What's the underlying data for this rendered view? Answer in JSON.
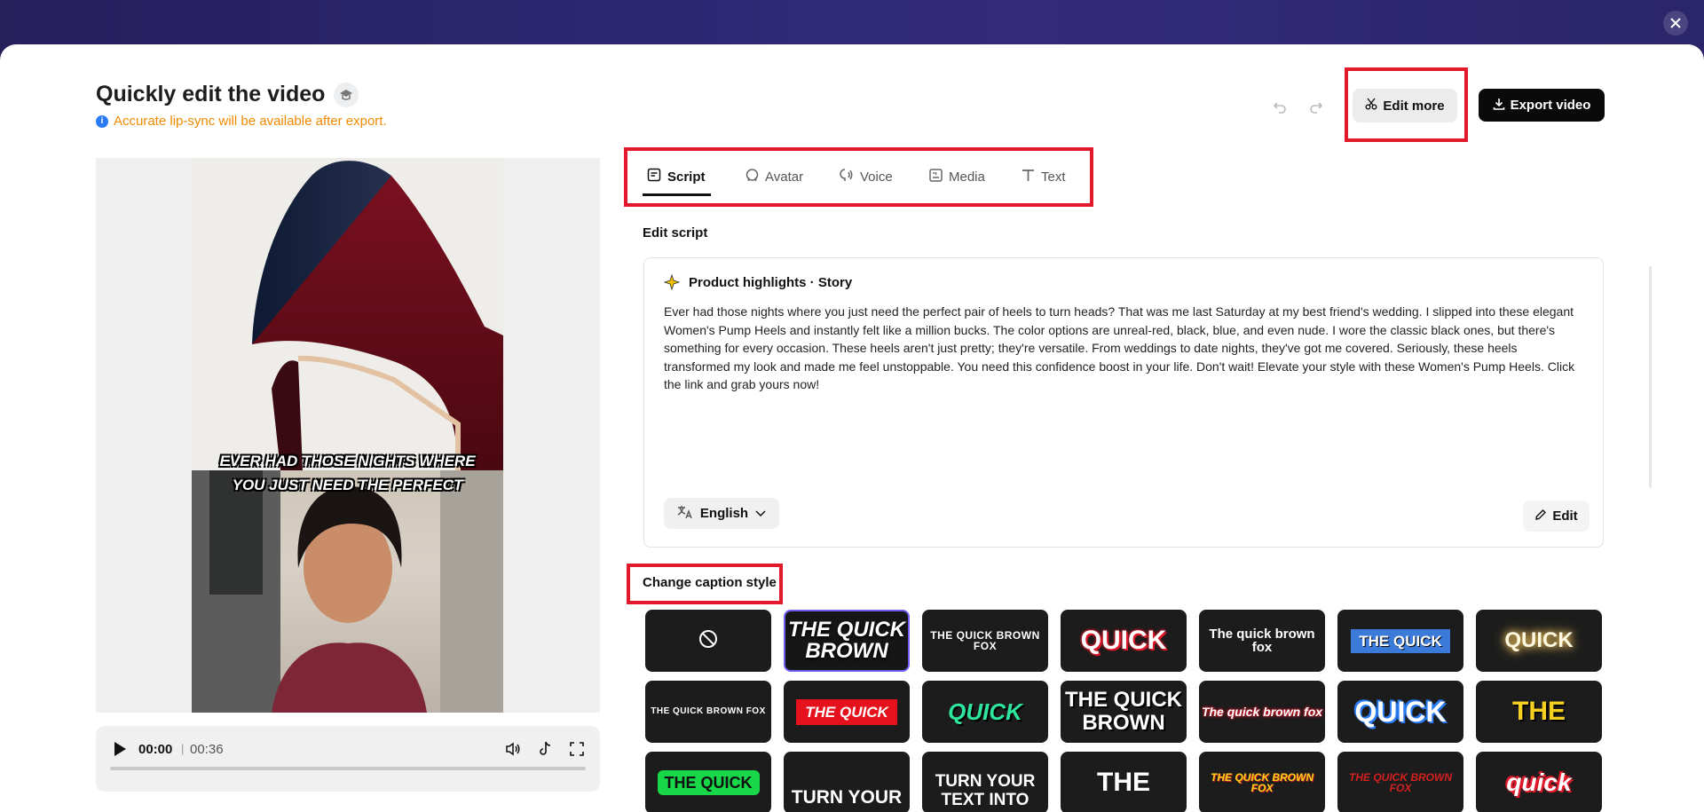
{
  "app": {
    "title": "Quickly edit the video",
    "notice": "Accurate lip-sync will be available after export."
  },
  "toolbar": {
    "edit_more": "Edit more",
    "export": "Export video"
  },
  "player": {
    "current_time": "00:00",
    "separator": "|",
    "total_time": "00:36",
    "progress": 0
  },
  "preview": {
    "caption_line1": "EVER HAD THOSE NIGHTS WHERE",
    "caption_line2": "YOU JUST NEED THE PERFECT"
  },
  "tabs": [
    {
      "label": "Script",
      "icon": "script-icon",
      "active": true
    },
    {
      "label": "Avatar",
      "icon": "avatar-icon",
      "active": false
    },
    {
      "label": "Voice",
      "icon": "voice-icon",
      "active": false
    },
    {
      "label": "Media",
      "icon": "media-icon",
      "active": false
    },
    {
      "label": "Text",
      "icon": "text-icon",
      "active": false
    }
  ],
  "script": {
    "section_label": "Edit script",
    "card_title": "Product highlights · Story",
    "text": "Ever had those nights where you just need the perfect pair of heels to turn heads? That was me last Saturday at my best friend's wedding. I slipped into these elegant Women's Pump Heels and instantly felt like a million bucks. The color options are unreal-red, black, blue, and even nude. I wore the classic black ones, but there's something for every occasion. These heels aren't just pretty; they're versatile. From weddings to date nights, they've got me covered. Seriously, these heels transformed my look and made me feel unstoppable. You need this confidence boost in your life. Don't wait! Elevate your style with these Women's Pump Heels. Click the link and grab yours now!",
    "language": "English",
    "edit_label": "Edit"
  },
  "captions": {
    "header": "Change caption style",
    "styles": [
      {
        "text": "",
        "icon": "none-icon"
      },
      {
        "text": "THE QUICK BROWN",
        "selected": true
      },
      {
        "text": "THE QUICK BROWN FOX"
      },
      {
        "text": "QUICK"
      },
      {
        "text": "The quick brown fox"
      },
      {
        "text": "THE QUICK"
      },
      {
        "text": "QUICK"
      },
      {
        "text": "THE QUICK BROWN FOX"
      },
      {
        "text": "THE QUICK"
      },
      {
        "text": "QUICK"
      },
      {
        "text": "THE QUICK BROWN"
      },
      {
        "text": "The quick brown fox"
      },
      {
        "text": "QUICK"
      },
      {
        "text": "THE"
      },
      {
        "text": "THE QUICK"
      },
      {
        "text": "TURN YOUR"
      },
      {
        "text": "TURN YOUR TEXT INTO"
      },
      {
        "text": "THE"
      },
      {
        "text": "THE QUICK BROWN FOX"
      },
      {
        "text": "THE QUICK BROWN FOX"
      },
      {
        "text": "quick"
      }
    ]
  },
  "colors": {
    "accent": "#6e5ff2",
    "highlight_box": "#e1192b",
    "notice": "#f08a00",
    "primary_button": "#0a0a0a"
  }
}
